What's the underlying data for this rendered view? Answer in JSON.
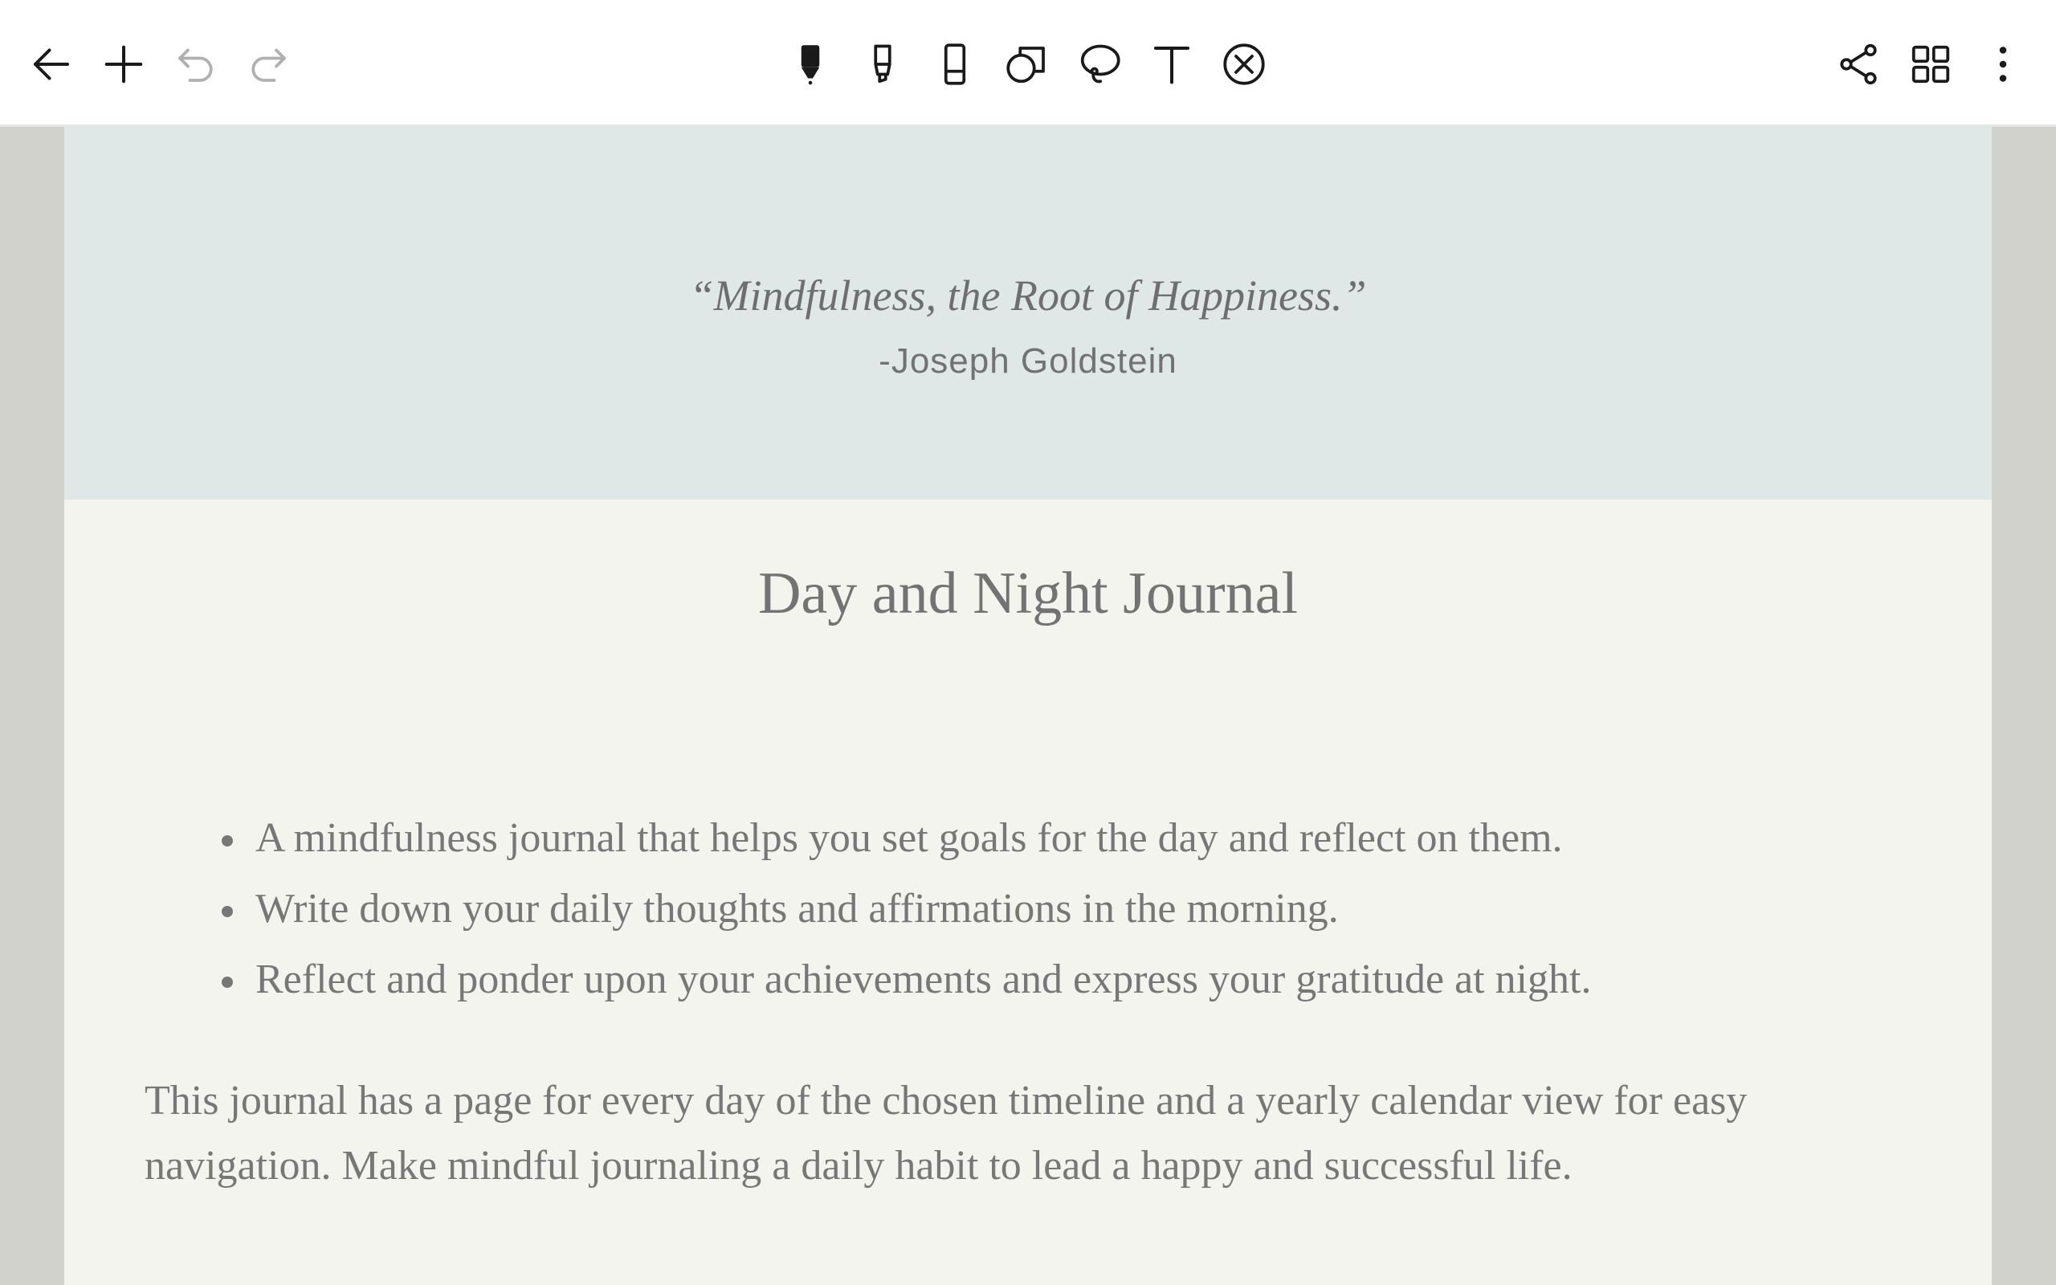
{
  "toolbar": {
    "left_tools": [
      {
        "name": "back",
        "icon": "arrow-left-icon",
        "enabled": true
      },
      {
        "name": "add-page",
        "icon": "plus-icon",
        "enabled": true
      },
      {
        "name": "undo",
        "icon": "undo-icon",
        "enabled": false
      },
      {
        "name": "redo",
        "icon": "redo-icon",
        "enabled": false
      }
    ],
    "center_tools": [
      {
        "name": "pen",
        "icon": "fountain-pen-icon",
        "selected": true
      },
      {
        "name": "highlighter",
        "icon": "highlighter-icon",
        "selected": false
      },
      {
        "name": "eraser",
        "icon": "eraser-icon",
        "selected": false
      },
      {
        "name": "shapes",
        "icon": "shapes-icon",
        "selected": false
      },
      {
        "name": "lasso",
        "icon": "lasso-icon",
        "selected": false
      },
      {
        "name": "text",
        "icon": "text-tool-icon",
        "selected": false
      },
      {
        "name": "no-touch",
        "icon": "touch-disabled-icon",
        "selected": false
      }
    ],
    "right_tools": [
      {
        "name": "share",
        "icon": "share-icon"
      },
      {
        "name": "page-overview",
        "icon": "grid-icon"
      },
      {
        "name": "more",
        "icon": "more-vertical-icon"
      }
    ]
  },
  "page": {
    "quote": "“Mindfulness, the Root of Happiness.”",
    "quote_author": "-Joseph Goldstein",
    "title": "Day and Night Journal",
    "bullets": [
      "A mindfulness journal that helps you set goals for the day and reflect on them.",
      "Write down your daily thoughts and affirmations in the morning.",
      "Reflect and ponder upon your achievements and express your gratitude at night."
    ],
    "paragraph": "This journal has a page for every day of the chosen timeline and a yearly calendar view for easy navigation. Make mindful journaling a daily habit to lead a happy and successful life."
  },
  "colors": {
    "toolbar_bg": "#ffffff",
    "workspace_bg": "#d2d2cd",
    "page_bg": "#f4f4ef",
    "banner_bg": "#e0e7e7",
    "text": "#777777",
    "icon_active": "#1a1a1a",
    "icon_disabled": "#b0b0b0"
  }
}
